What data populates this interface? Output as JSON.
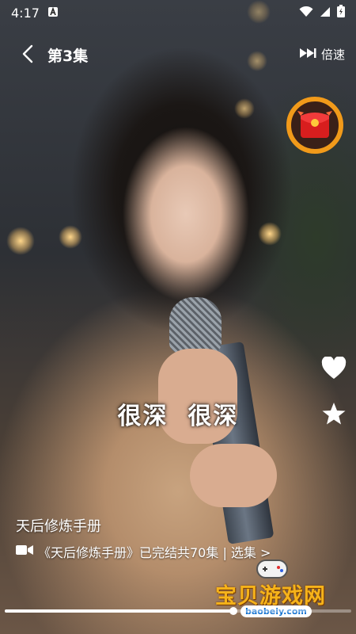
{
  "status_bar": {
    "time": "4:17",
    "icons": [
      "a-badge-icon",
      "wifi-icon",
      "signal-icon",
      "battery-icon"
    ]
  },
  "top_bar": {
    "back_icon": "chevron-left-icon",
    "episode_title": "第3集",
    "speed_label": "倍速",
    "speed_icon": "fast-forward-icon"
  },
  "red_packet": {
    "icon": "red-envelope-icon",
    "ring_color": "#f19a1a"
  },
  "side_actions": [
    {
      "name": "like",
      "icon": "heart-icon"
    },
    {
      "name": "favorite",
      "icon": "star-icon"
    }
  ],
  "subtitle": "很深  很深",
  "show": {
    "title": "天后修炼手册",
    "series_icon": "video-camera-icon",
    "series_text": "《天后修炼手册》已完结共70集 | 选集 >"
  },
  "progress": {
    "played_fraction": 0.66,
    "fill_color": "#ffffff"
  },
  "watermark": {
    "brand": "宝贝游戏网",
    "url": "baobeiy.com"
  }
}
